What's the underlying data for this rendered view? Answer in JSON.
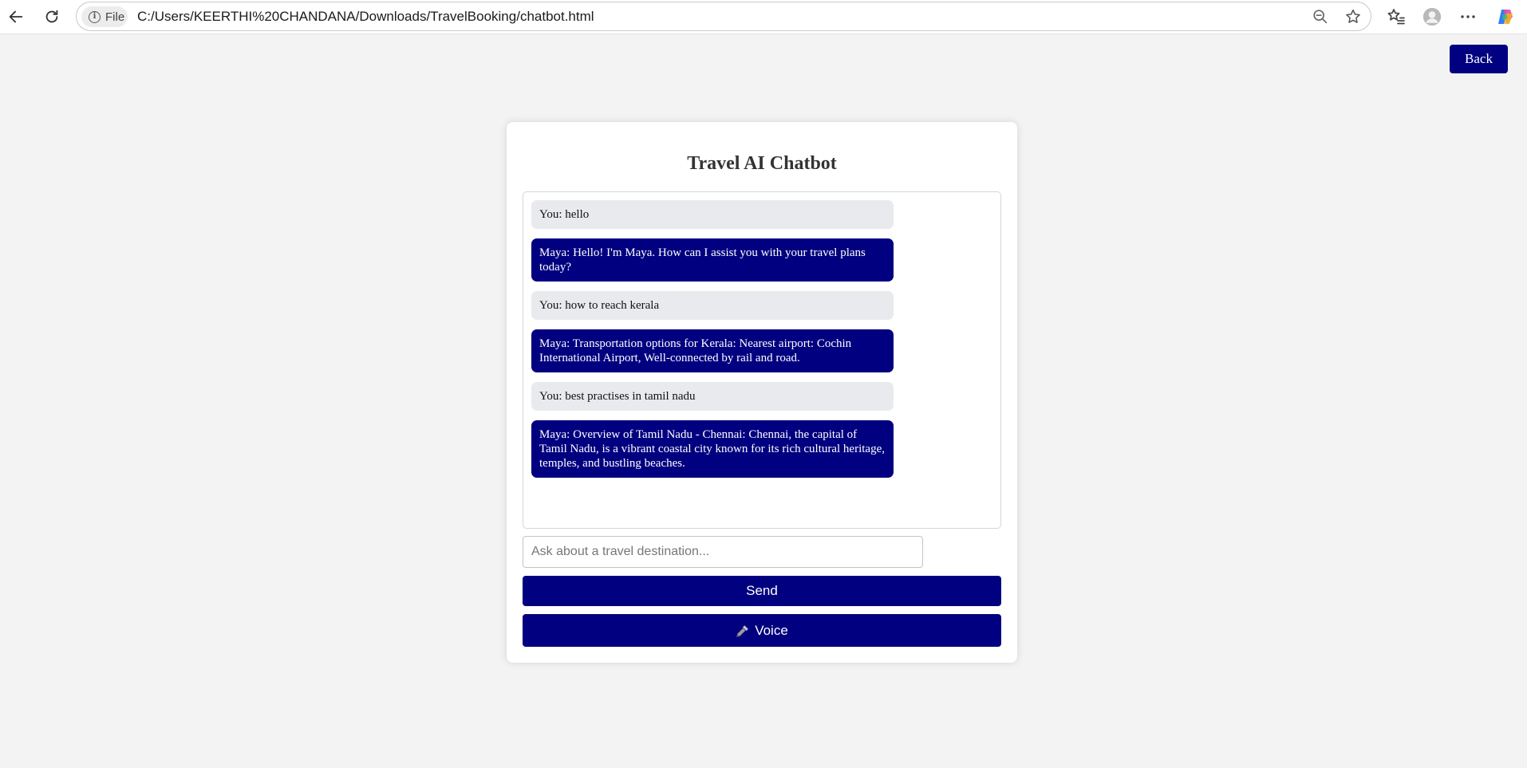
{
  "browser": {
    "file_label": "File",
    "url": "C:/Users/KEERTHI%20CHANDANA/Downloads/TravelBooking/chatbot.html"
  },
  "page": {
    "back_label": "Back",
    "title": "Travel AI Chatbot",
    "messages": [
      {
        "role": "user",
        "text": "You: hello"
      },
      {
        "role": "bot",
        "text": "Maya: Hello! I'm Maya. How can I assist you with your travel plans today?"
      },
      {
        "role": "user",
        "text": "You: how to reach kerala"
      },
      {
        "role": "bot",
        "text": "Maya: Transportation options for Kerala: Nearest airport: Cochin International Airport, Well-connected by rail and road."
      },
      {
        "role": "user",
        "text": "You: best practises in tamil nadu"
      },
      {
        "role": "bot",
        "text": "Maya: Overview of Tamil Nadu - Chennai: Chennai, the capital of Tamil Nadu, is a vibrant coastal city known for its rich cultural heritage, temples, and bustling beaches."
      }
    ],
    "input_placeholder": "Ask about a travel destination...",
    "input_value": "",
    "send_label": "Send",
    "voice_label": "Voice",
    "voice_icon": "microphone-icon"
  },
  "colors": {
    "accent": "#000080",
    "user_bubble": "#e8eaed",
    "page_bg": "#f3f3f3"
  }
}
